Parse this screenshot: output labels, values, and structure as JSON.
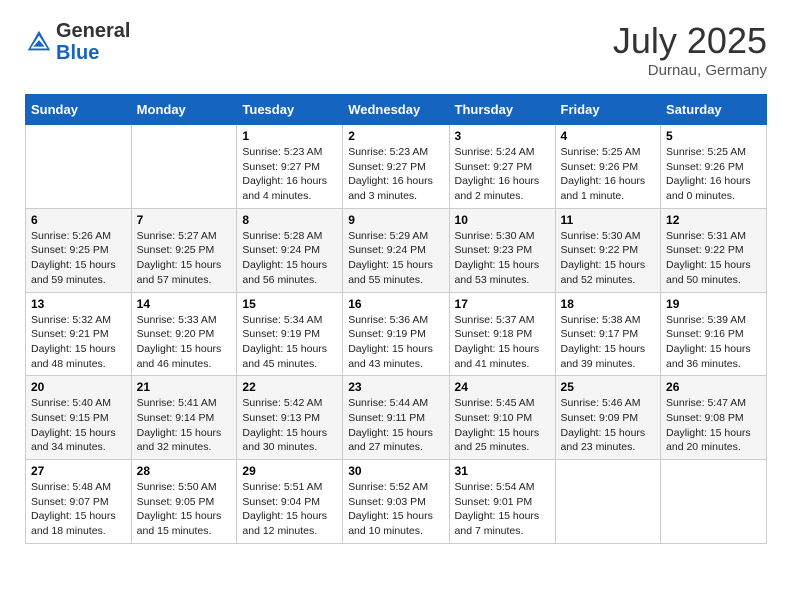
{
  "header": {
    "logo_general": "General",
    "logo_blue": "Blue",
    "month_year": "July 2025",
    "location": "Durnau, Germany"
  },
  "days_of_week": [
    "Sunday",
    "Monday",
    "Tuesday",
    "Wednesday",
    "Thursday",
    "Friday",
    "Saturday"
  ],
  "weeks": [
    [
      {
        "day": "",
        "sunrise": "",
        "sunset": "",
        "daylight": ""
      },
      {
        "day": "",
        "sunrise": "",
        "sunset": "",
        "daylight": ""
      },
      {
        "day": "1",
        "sunrise": "Sunrise: 5:23 AM",
        "sunset": "Sunset: 9:27 PM",
        "daylight": "Daylight: 16 hours and 4 minutes."
      },
      {
        "day": "2",
        "sunrise": "Sunrise: 5:23 AM",
        "sunset": "Sunset: 9:27 PM",
        "daylight": "Daylight: 16 hours and 3 minutes."
      },
      {
        "day": "3",
        "sunrise": "Sunrise: 5:24 AM",
        "sunset": "Sunset: 9:27 PM",
        "daylight": "Daylight: 16 hours and 2 minutes."
      },
      {
        "day": "4",
        "sunrise": "Sunrise: 5:25 AM",
        "sunset": "Sunset: 9:26 PM",
        "daylight": "Daylight: 16 hours and 1 minute."
      },
      {
        "day": "5",
        "sunrise": "Sunrise: 5:25 AM",
        "sunset": "Sunset: 9:26 PM",
        "daylight": "Daylight: 16 hours and 0 minutes."
      }
    ],
    [
      {
        "day": "6",
        "sunrise": "Sunrise: 5:26 AM",
        "sunset": "Sunset: 9:25 PM",
        "daylight": "Daylight: 15 hours and 59 minutes."
      },
      {
        "day": "7",
        "sunrise": "Sunrise: 5:27 AM",
        "sunset": "Sunset: 9:25 PM",
        "daylight": "Daylight: 15 hours and 57 minutes."
      },
      {
        "day": "8",
        "sunrise": "Sunrise: 5:28 AM",
        "sunset": "Sunset: 9:24 PM",
        "daylight": "Daylight: 15 hours and 56 minutes."
      },
      {
        "day": "9",
        "sunrise": "Sunrise: 5:29 AM",
        "sunset": "Sunset: 9:24 PM",
        "daylight": "Daylight: 15 hours and 55 minutes."
      },
      {
        "day": "10",
        "sunrise": "Sunrise: 5:30 AM",
        "sunset": "Sunset: 9:23 PM",
        "daylight": "Daylight: 15 hours and 53 minutes."
      },
      {
        "day": "11",
        "sunrise": "Sunrise: 5:30 AM",
        "sunset": "Sunset: 9:22 PM",
        "daylight": "Daylight: 15 hours and 52 minutes."
      },
      {
        "day": "12",
        "sunrise": "Sunrise: 5:31 AM",
        "sunset": "Sunset: 9:22 PM",
        "daylight": "Daylight: 15 hours and 50 minutes."
      }
    ],
    [
      {
        "day": "13",
        "sunrise": "Sunrise: 5:32 AM",
        "sunset": "Sunset: 9:21 PM",
        "daylight": "Daylight: 15 hours and 48 minutes."
      },
      {
        "day": "14",
        "sunrise": "Sunrise: 5:33 AM",
        "sunset": "Sunset: 9:20 PM",
        "daylight": "Daylight: 15 hours and 46 minutes."
      },
      {
        "day": "15",
        "sunrise": "Sunrise: 5:34 AM",
        "sunset": "Sunset: 9:19 PM",
        "daylight": "Daylight: 15 hours and 45 minutes."
      },
      {
        "day": "16",
        "sunrise": "Sunrise: 5:36 AM",
        "sunset": "Sunset: 9:19 PM",
        "daylight": "Daylight: 15 hours and 43 minutes."
      },
      {
        "day": "17",
        "sunrise": "Sunrise: 5:37 AM",
        "sunset": "Sunset: 9:18 PM",
        "daylight": "Daylight: 15 hours and 41 minutes."
      },
      {
        "day": "18",
        "sunrise": "Sunrise: 5:38 AM",
        "sunset": "Sunset: 9:17 PM",
        "daylight": "Daylight: 15 hours and 39 minutes."
      },
      {
        "day": "19",
        "sunrise": "Sunrise: 5:39 AM",
        "sunset": "Sunset: 9:16 PM",
        "daylight": "Daylight: 15 hours and 36 minutes."
      }
    ],
    [
      {
        "day": "20",
        "sunrise": "Sunrise: 5:40 AM",
        "sunset": "Sunset: 9:15 PM",
        "daylight": "Daylight: 15 hours and 34 minutes."
      },
      {
        "day": "21",
        "sunrise": "Sunrise: 5:41 AM",
        "sunset": "Sunset: 9:14 PM",
        "daylight": "Daylight: 15 hours and 32 minutes."
      },
      {
        "day": "22",
        "sunrise": "Sunrise: 5:42 AM",
        "sunset": "Sunset: 9:13 PM",
        "daylight": "Daylight: 15 hours and 30 minutes."
      },
      {
        "day": "23",
        "sunrise": "Sunrise: 5:44 AM",
        "sunset": "Sunset: 9:11 PM",
        "daylight": "Daylight: 15 hours and 27 minutes."
      },
      {
        "day": "24",
        "sunrise": "Sunrise: 5:45 AM",
        "sunset": "Sunset: 9:10 PM",
        "daylight": "Daylight: 15 hours and 25 minutes."
      },
      {
        "day": "25",
        "sunrise": "Sunrise: 5:46 AM",
        "sunset": "Sunset: 9:09 PM",
        "daylight": "Daylight: 15 hours and 23 minutes."
      },
      {
        "day": "26",
        "sunrise": "Sunrise: 5:47 AM",
        "sunset": "Sunset: 9:08 PM",
        "daylight": "Daylight: 15 hours and 20 minutes."
      }
    ],
    [
      {
        "day": "27",
        "sunrise": "Sunrise: 5:48 AM",
        "sunset": "Sunset: 9:07 PM",
        "daylight": "Daylight: 15 hours and 18 minutes."
      },
      {
        "day": "28",
        "sunrise": "Sunrise: 5:50 AM",
        "sunset": "Sunset: 9:05 PM",
        "daylight": "Daylight: 15 hours and 15 minutes."
      },
      {
        "day": "29",
        "sunrise": "Sunrise: 5:51 AM",
        "sunset": "Sunset: 9:04 PM",
        "daylight": "Daylight: 15 hours and 12 minutes."
      },
      {
        "day": "30",
        "sunrise": "Sunrise: 5:52 AM",
        "sunset": "Sunset: 9:03 PM",
        "daylight": "Daylight: 15 hours and 10 minutes."
      },
      {
        "day": "31",
        "sunrise": "Sunrise: 5:54 AM",
        "sunset": "Sunset: 9:01 PM",
        "daylight": "Daylight: 15 hours and 7 minutes."
      },
      {
        "day": "",
        "sunrise": "",
        "sunset": "",
        "daylight": ""
      },
      {
        "day": "",
        "sunrise": "",
        "sunset": "",
        "daylight": ""
      }
    ]
  ]
}
